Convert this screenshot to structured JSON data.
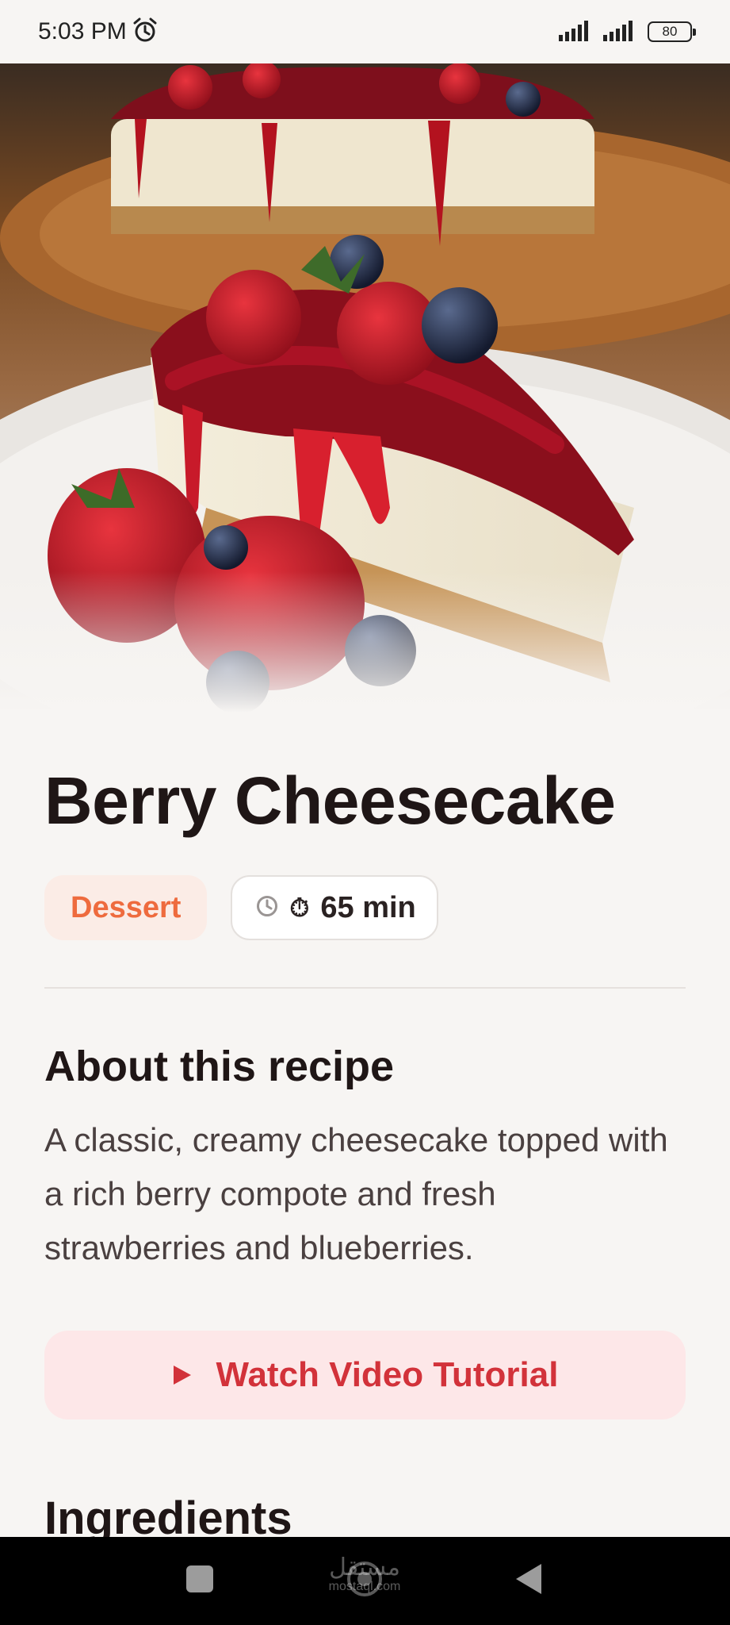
{
  "status_bar": {
    "time": "5:03 PM",
    "battery": "80",
    "icons": [
      "alarm-icon",
      "signal-icon",
      "signal-icon",
      "battery-icon"
    ]
  },
  "recipe": {
    "title": "Berry Cheesecake",
    "category": "Dessert",
    "time_label": "65 min",
    "time_emoji": "⏱",
    "about_heading": "About this recipe",
    "description": "A classic, creamy cheesecake topped with a rich berry compote and fresh strawberries and blueberries.",
    "video_button_label": "Watch Video Tutorial",
    "ingredients_heading": "Ingredients"
  },
  "nav_bar": {
    "icons": [
      "recent-apps-icon",
      "home-icon",
      "back-icon"
    ],
    "watermark": {
      "arabic": "مستقل",
      "latin": "mostaql.com"
    }
  },
  "colors": {
    "background": "#f7f5f3",
    "accent_orange": "#ee6b3e",
    "accent_red": "#d2323a",
    "category_chip_bg": "#fbece6",
    "video_button_bg": "#fde7e8"
  }
}
